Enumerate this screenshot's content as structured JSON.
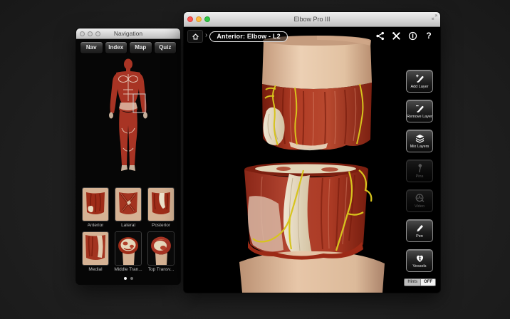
{
  "nav_window": {
    "title": "Navigation",
    "tabs": [
      "Nav",
      "Index",
      "Map",
      "Quiz"
    ],
    "thumbnails": [
      "Anterior",
      "Lateral",
      "Posterior",
      "Medial",
      "Middle Tran...",
      "Top Transv..."
    ],
    "page_dots": {
      "count": 2,
      "active_index": 0
    }
  },
  "main_window": {
    "title": "Elbow Pro III",
    "breadcrumb": {
      "chevron": "›",
      "label": "Anterior: Elbow - L2"
    },
    "toolbar": {
      "help_glyph": "?"
    },
    "side_buttons": [
      {
        "label": "Add Layer",
        "enabled": true
      },
      {
        "label": "Remove Layer",
        "enabled": true
      },
      {
        "label": "Mix Layers",
        "enabled": true
      },
      {
        "label": "Pins",
        "enabled": false
      },
      {
        "label": "Video",
        "enabled": false
      },
      {
        "label": "Pen",
        "enabled": true
      },
      {
        "label": "Vessels",
        "enabled": true
      }
    ],
    "hints_toggle": {
      "label": "Hints",
      "state": "OFF"
    }
  },
  "colors": {
    "muscle_red": "#a93120",
    "nerve_yellow": "#d7c41d",
    "skin": "#e2c0a2",
    "tendon_cream": "#e9dcc0"
  }
}
